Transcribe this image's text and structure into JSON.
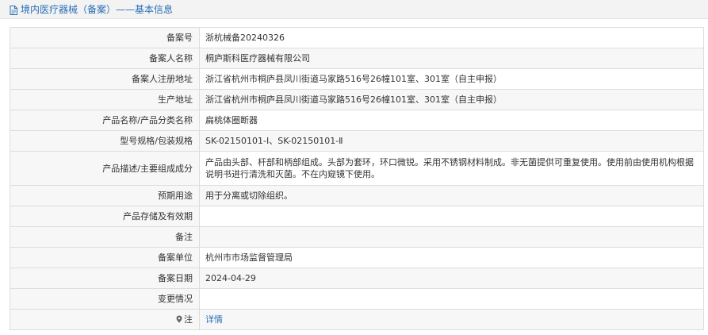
{
  "header": {
    "title": "境内医疗器械（备案）——基本信息"
  },
  "rows": {
    "record_no": {
      "label": "备案号",
      "value": "浙杭械备20240326"
    },
    "registrant": {
      "label": "备案人名称",
      "value": "桐庐斯科医疗器械有限公司"
    },
    "registered_address": {
      "label": "备案人注册地址",
      "value": "浙江省杭州市桐庐县凤川街道马家路516号26幢101室、301室（自主申报）"
    },
    "production_address": {
      "label": "生产地址",
      "value": "浙江省杭州市桐庐县凤川街道马家路516号26幢101室、301室（自主申报）"
    },
    "product_name": {
      "label": "产品名称/产品分类名称",
      "value": "扁桃体圈断器"
    },
    "model_spec": {
      "label": "型号规格/包装规格",
      "value": "SK-02150101-Ⅰ、SK-02150101-Ⅱ"
    },
    "description": {
      "label": "产品描述/主要组成成分",
      "value": "产品由头部、杆部和柄部组成。头部为套环，环口微锐。采用不锈钢材料制成。非无菌提供可重复使用。使用前由使用机构根据说明书进行清洗和灭菌。不在内窥镜下使用。"
    },
    "intended_use": {
      "label": "预期用途",
      "value": "用于分离或切除组织。"
    },
    "storage": {
      "label": "产品存储及有效期",
      "value": ""
    },
    "remarks": {
      "label": "备注",
      "value": ""
    },
    "agency": {
      "label": "备案单位",
      "value": "杭州市市场监督管理局"
    },
    "record_date": {
      "label": "备案日期",
      "value": "2024-04-29"
    },
    "changes": {
      "label": "变更情况",
      "value": ""
    },
    "note": {
      "label": "注",
      "value": "详情"
    }
  },
  "colors": {
    "link": "#2a6fb5",
    "border": "#dddddd",
    "label_bg": "#f7f7f7"
  }
}
